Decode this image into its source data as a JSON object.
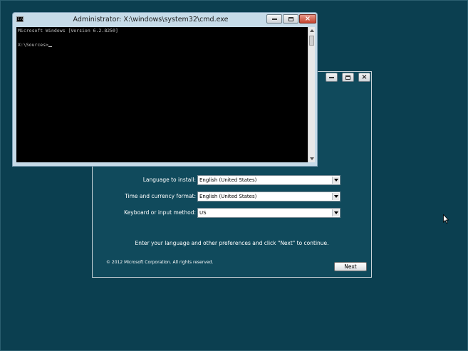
{
  "setup_window": {
    "fields": [
      {
        "label": "Language to install:",
        "value": "English (United States)"
      },
      {
        "label": "Time and currency format:",
        "value": "English (United States)"
      },
      {
        "label": "Keyboard or input method:",
        "value": "US"
      }
    ],
    "instruction": "Enter your language and other preferences and click \"Next\" to continue.",
    "copyright": "© 2012 Microsoft Corporation. All rights reserved.",
    "next_label": "Next"
  },
  "cmd_window": {
    "title": "Administrator: X:\\windows\\system32\\cmd.exe",
    "icon_text": "C:\\",
    "lines": [
      "Microsoft Windows [Version 6.2.8250]",
      "",
      "X:\\Sources>"
    ]
  },
  "icons": {
    "minimize": "minimize-icon",
    "maximize": "maximize-icon",
    "close": "close-icon",
    "cmd": "cmd-icon",
    "pointer": "mouse-pointer-icon"
  },
  "colors": {
    "desktop": "#0b3f50",
    "setup_background": "#104a5c",
    "console_background": "#000000",
    "console_text": "#c0c0c0",
    "cmd_chrome": "#c6dbe8",
    "close_button": "#c4452f"
  }
}
